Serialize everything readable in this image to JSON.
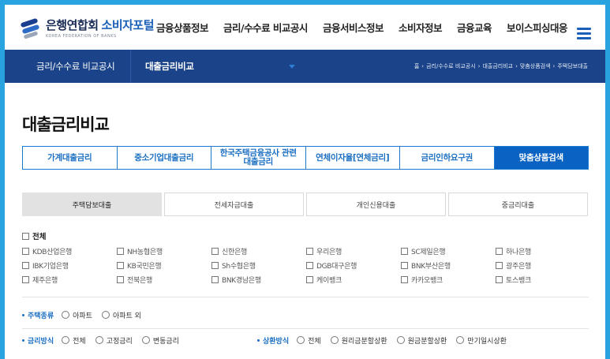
{
  "header": {
    "logo_main": "은행연합회",
    "logo_portal": "소비자포털",
    "logo_sub": "KOREA FEDERATION OF BANKS",
    "gnb": [
      "금융상품정보",
      "금리/수수료 비교공시",
      "금융서비스정보",
      "소비자정보",
      "금융교육",
      "보이스피싱대응"
    ]
  },
  "subnav": {
    "section": "금리/수수료 비교공시",
    "current": "대출금리비교",
    "breadcrumb": [
      "홈",
      "금리/수수료 비교공시",
      "대출금리비교",
      "맞춤상품검색",
      "주택담보대출"
    ]
  },
  "page_title": "대출금리비교",
  "tabs": [
    {
      "label": "가계대출금리",
      "active": false
    },
    {
      "label": "중소기업대출금리",
      "active": false
    },
    {
      "label": "한국주택금융공사 관련\n대출금리",
      "active": false
    },
    {
      "label": "연체이자율[연체금리]",
      "active": false
    },
    {
      "label": "금리인하요구권",
      "active": false
    },
    {
      "label": "맞춤상품검색",
      "active": true
    }
  ],
  "subtabs": [
    {
      "label": "주택담보대출",
      "active": true
    },
    {
      "label": "전세자금대출",
      "active": false
    },
    {
      "label": "개인신용대출",
      "active": false
    },
    {
      "label": "중금리대출",
      "active": false
    }
  ],
  "banks": {
    "all_label": "전체",
    "list": [
      "KDB산업은행",
      "NH농협은행",
      "신한은행",
      "우리은행",
      "SC제일은행",
      "하나은행",
      "IBK기업은행",
      "KB국민은행",
      "Sh수협은행",
      "DGB대구은행",
      "BNK부산은행",
      "광주은행",
      "제주은행",
      "전북은행",
      "BNK경남은행",
      "케이뱅크",
      "카카오뱅크",
      "토스뱅크"
    ]
  },
  "filters": {
    "housing_type": {
      "label": "주택종류",
      "options": [
        "아파트",
        "아파트 외"
      ]
    },
    "rate_type": {
      "label": "금리방식",
      "options": [
        "전체",
        "고정금리",
        "변동금리"
      ]
    },
    "repay_type": {
      "label": "상환방식",
      "options": [
        "전체",
        "원리금분할상환",
        "원금분할상환",
        "만기일시상환"
      ]
    }
  },
  "colors": {
    "frame": "#29a3e0",
    "navbar": "#1a4389",
    "accent": "#0a63c2"
  }
}
